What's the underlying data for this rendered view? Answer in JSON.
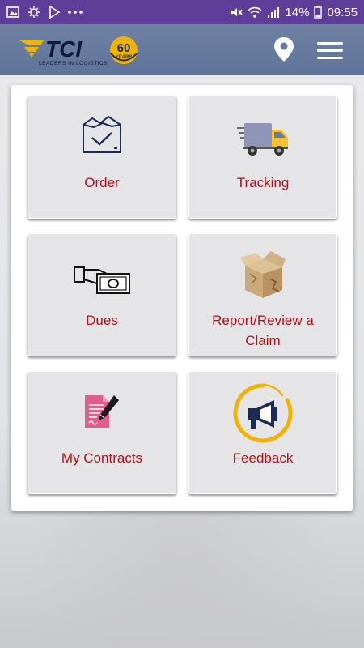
{
  "status_bar": {
    "battery": "14%",
    "time": "09:55",
    "left_icons": [
      "image-icon",
      "sync-icon",
      "play-store-icon",
      "more-dots-icon"
    ],
    "right_icons": [
      "mute-icon",
      "wifi-icon",
      "signal-icon",
      "battery-icon"
    ]
  },
  "header": {
    "logo_text": "TCI",
    "tagline": "LEADERS IN LOGISTICS",
    "badge_number": "60",
    "badge_text": "YEARS",
    "actions": [
      "location-pin-icon",
      "hamburger-menu-icon"
    ]
  },
  "menu": {
    "tiles": [
      {
        "label": "Order",
        "icon": "order-box-icon"
      },
      {
        "label": "Tracking",
        "icon": "delivery-truck-icon"
      },
      {
        "label": "Dues",
        "icon": "money-hand-icon"
      },
      {
        "label_line1": "Report/Review a",
        "label_line2": "Claim",
        "icon": "damaged-box-icon"
      },
      {
        "label": "My Contracts",
        "icon": "contract-pen-icon"
      },
      {
        "label": "Feedback",
        "icon": "megaphone-icon"
      }
    ]
  },
  "colors": {
    "status_bar": "#5e3e99",
    "app_bar": "#6679a0",
    "tile_label": "#b01218",
    "tile_bg": "#e5e4e6",
    "brand_yellow": "#f0b400",
    "brand_dark": "#1c2a55"
  }
}
